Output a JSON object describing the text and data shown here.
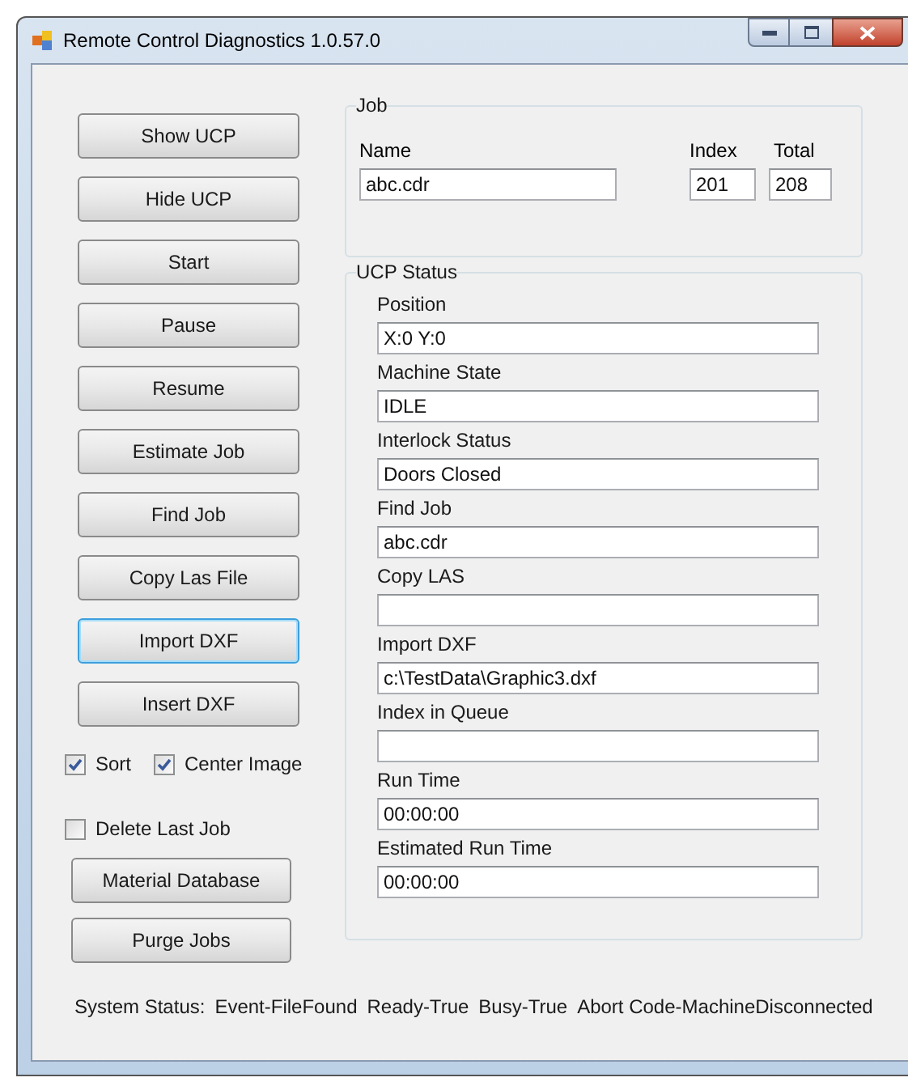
{
  "window": {
    "title": "Remote Control Diagnostics 1.0.57.0"
  },
  "buttons": [
    {
      "label": "Show UCP",
      "focused": false
    },
    {
      "label": "Hide UCP",
      "focused": false
    },
    {
      "label": "Start",
      "focused": false
    },
    {
      "label": "Pause",
      "focused": false
    },
    {
      "label": "Resume",
      "focused": false
    },
    {
      "label": "Estimate Job",
      "focused": false
    },
    {
      "label": "Find Job",
      "focused": false
    },
    {
      "label": "Copy Las File",
      "focused": false
    },
    {
      "label": "Import DXF",
      "focused": true
    },
    {
      "label": "Insert DXF",
      "focused": false
    }
  ],
  "checkbox_rows": [
    {
      "items": [
        {
          "label": "Sort",
          "checked": true
        },
        {
          "label": "Center Image",
          "checked": true
        }
      ]
    },
    {
      "items": [
        {
          "label": "Delete Last Job",
          "checked": false
        }
      ]
    }
  ],
  "lower_buttons": [
    {
      "label": "Material Database",
      "focused": false
    },
    {
      "label": "Purge Jobs",
      "focused": false
    }
  ],
  "job": {
    "title": "Job",
    "name": {
      "label": "Name",
      "value": "abc.cdr"
    },
    "index": {
      "label": "Index",
      "value": "201"
    },
    "total": {
      "label": "Total",
      "value": "208"
    }
  },
  "ucp_status": {
    "title": "UCP Status",
    "fields": [
      {
        "label": "Position",
        "value": "X:0 Y:0"
      },
      {
        "label": "Machine State",
        "value": "IDLE"
      },
      {
        "label": "Interlock Status",
        "value": "Doors Closed"
      },
      {
        "label": "Find Job",
        "value": "abc.cdr"
      },
      {
        "label": "Copy LAS"
      },
      {
        "label": "Import DXF",
        "value": "c:\\TestData\\Graphic3.dxf"
      },
      {
        "label": "Index in Queue"
      },
      {
        "label": "Run Time",
        "value": "00:00:00"
      },
      {
        "label": "Estimated Run Time",
        "value": "00:00:00"
      }
    ]
  },
  "status_bar": {
    "label": "System Status:",
    "items": [
      "Event-FileFound",
      "Ready-True",
      "Busy-True",
      "Abort Code-MachineDisconnected"
    ]
  }
}
